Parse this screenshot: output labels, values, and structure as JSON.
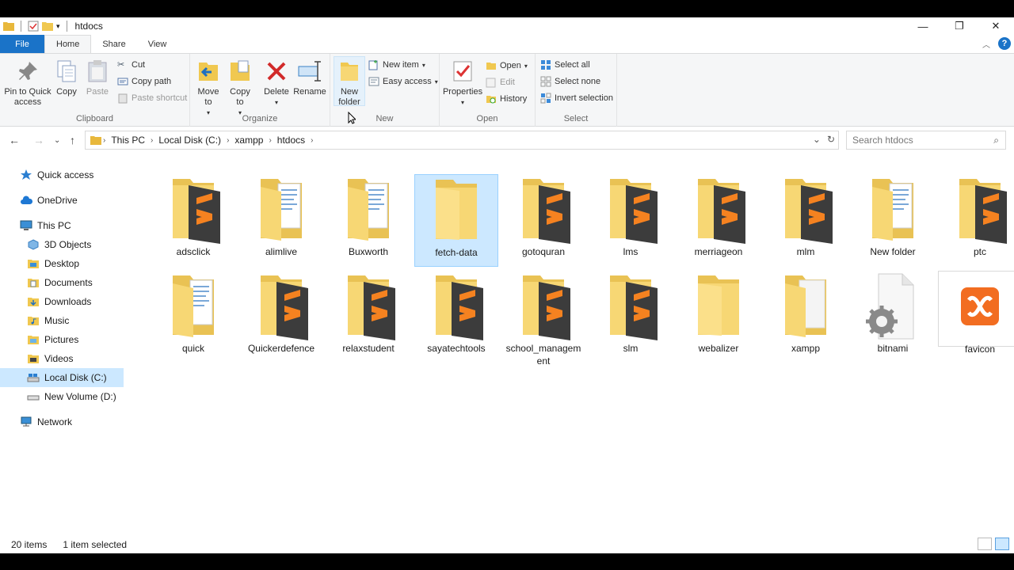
{
  "window": {
    "title": "htdocs"
  },
  "tabs": [
    "File",
    "Home",
    "Share",
    "View"
  ],
  "ribbon": {
    "clipboard": {
      "label": "Clipboard",
      "pin": "Pin to Quick access",
      "copy": "Copy",
      "paste": "Paste",
      "cut": "Cut",
      "copy_path": "Copy path",
      "paste_shortcut": "Paste shortcut"
    },
    "organize": {
      "label": "Organize",
      "move_to": "Move to",
      "copy_to": "Copy to",
      "delete": "Delete",
      "rename": "Rename"
    },
    "new": {
      "label": "New",
      "new_folder": "New folder",
      "new_item": "New item",
      "easy_access": "Easy access"
    },
    "open": {
      "label": "Open",
      "properties": "Properties",
      "open": "Open",
      "edit": "Edit",
      "history": "History"
    },
    "select": {
      "label": "Select",
      "select_all": "Select all",
      "select_none": "Select none",
      "invert": "Invert selection"
    }
  },
  "address": {
    "crumbs": [
      "This PC",
      "Local Disk (C:)",
      "xampp",
      "htdocs"
    ],
    "search_placeholder": "Search htdocs"
  },
  "sidebar": [
    {
      "label": "Quick access",
      "icon": "star-icon"
    },
    {
      "label": "OneDrive",
      "icon": "cloud-icon"
    },
    {
      "label": "This PC",
      "icon": "computer-icon"
    },
    {
      "label": "3D Objects",
      "icon": "cube-icon"
    },
    {
      "label": "Desktop",
      "icon": "desktop-icon"
    },
    {
      "label": "Documents",
      "icon": "documents-icon"
    },
    {
      "label": "Downloads",
      "icon": "downloads-icon"
    },
    {
      "label": "Music",
      "icon": "music-icon"
    },
    {
      "label": "Pictures",
      "icon": "pictures-icon"
    },
    {
      "label": "Videos",
      "icon": "videos-icon"
    },
    {
      "label": "Local Disk (C:)",
      "icon": "drive-icon"
    },
    {
      "label": "New Volume (D:)",
      "icon": "drive-icon"
    },
    {
      "label": "Network",
      "icon": "network-icon"
    }
  ],
  "items": [
    {
      "name": "adsclick",
      "type": "sublime-folder"
    },
    {
      "name": "alimlive",
      "type": "docs-folder"
    },
    {
      "name": "Buxworth",
      "type": "docs-folder"
    },
    {
      "name": "fetch-data",
      "type": "empty-folder",
      "selected": true
    },
    {
      "name": "gotoquran",
      "type": "sublime-folder"
    },
    {
      "name": "lms",
      "type": "sublime-folder"
    },
    {
      "name": "merriageon",
      "type": "sublime-folder"
    },
    {
      "name": "mlm",
      "type": "sublime-folder"
    },
    {
      "name": "New folder",
      "type": "docs-folder"
    },
    {
      "name": "ptc",
      "type": "sublime-folder"
    },
    {
      "name": "quick",
      "type": "docs-folder"
    },
    {
      "name": "Quickerdefence",
      "type": "sublime-folder"
    },
    {
      "name": "relaxstudent",
      "type": "sublime-folder"
    },
    {
      "name": "sayatechtools",
      "type": "sublime-folder"
    },
    {
      "name": "school_management",
      "type": "sublime-folder"
    },
    {
      "name": "slm",
      "type": "sublime-folder"
    },
    {
      "name": "webalizer",
      "type": "empty-folder"
    },
    {
      "name": "xampp",
      "type": "white-folder"
    },
    {
      "name": "bitnami",
      "type": "settings-file"
    },
    {
      "name": "favicon",
      "type": "xampp-icon"
    }
  ],
  "status": {
    "count": "20 items",
    "selection": "1 item selected"
  },
  "colors": {
    "accent": "#1a73c8",
    "selection": "#cce8ff",
    "folder": "#f7d774",
    "sublime_orange": "#f58220",
    "sublime_dark": "#3c3c3c"
  }
}
